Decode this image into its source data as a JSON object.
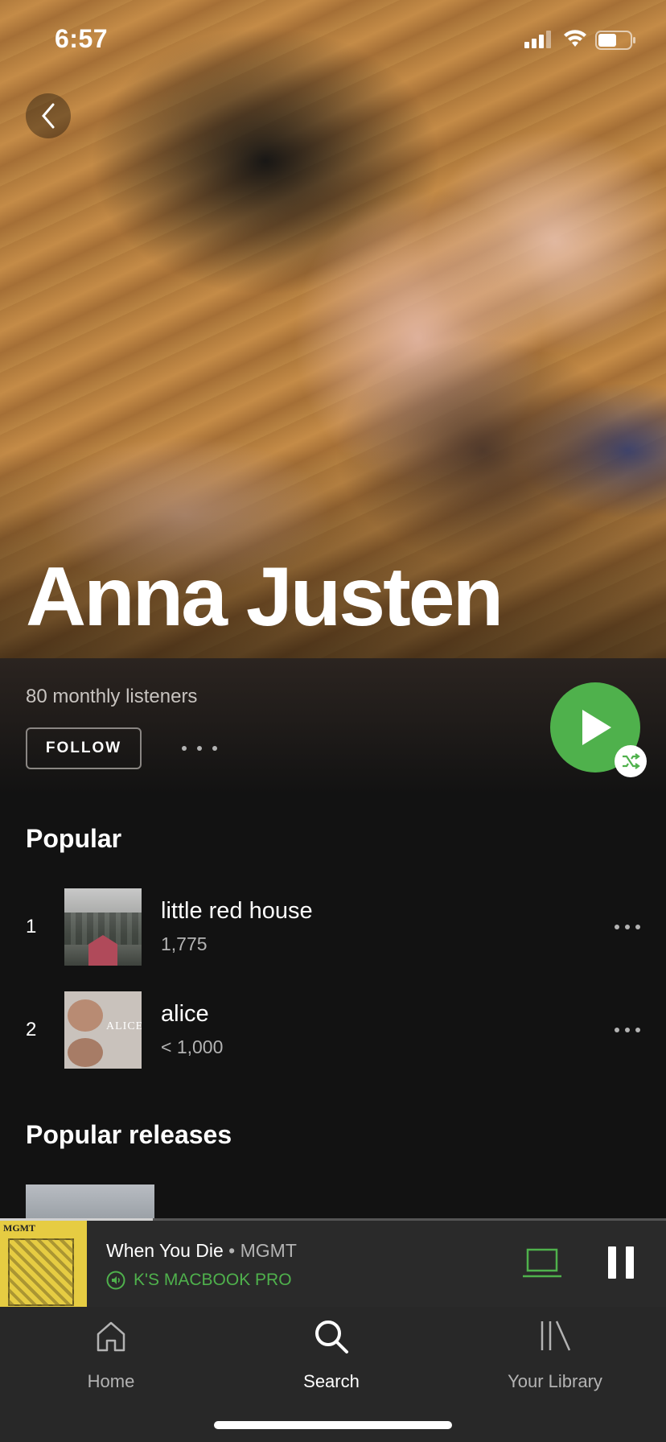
{
  "status_bar": {
    "time": "6:57",
    "signal_icon": "signal-icon",
    "wifi_icon": "wifi-icon",
    "battery_icon": "battery-icon"
  },
  "artist": {
    "name": "Anna Justen",
    "monthly_listeners": "80 monthly listeners",
    "follow_label": "FOLLOW"
  },
  "colors": {
    "accent_green": "#4fb14c",
    "background": "#121212",
    "player_bg": "#2a2a2a",
    "tabbar_bg": "#282828"
  },
  "popular": {
    "title": "Popular",
    "tracks": [
      {
        "number": "1",
        "title": "little red house",
        "plays": "1,775"
      },
      {
        "number": "2",
        "title": "alice",
        "plays": "< 1,000",
        "art_text": "ALICE"
      }
    ]
  },
  "popular_releases": {
    "title": "Popular releases"
  },
  "now_playing": {
    "song": "When You Die",
    "separator": "•",
    "artist": "MGMT",
    "device": "K'S MACBOOK PRO",
    "art_text": "MGMT",
    "progress": 0.23
  },
  "tabs": [
    {
      "label": "Home",
      "icon": "home-icon",
      "active": false
    },
    {
      "label": "Search",
      "icon": "search-icon",
      "active": true
    },
    {
      "label": "Your Library",
      "icon": "library-icon",
      "active": false
    }
  ]
}
